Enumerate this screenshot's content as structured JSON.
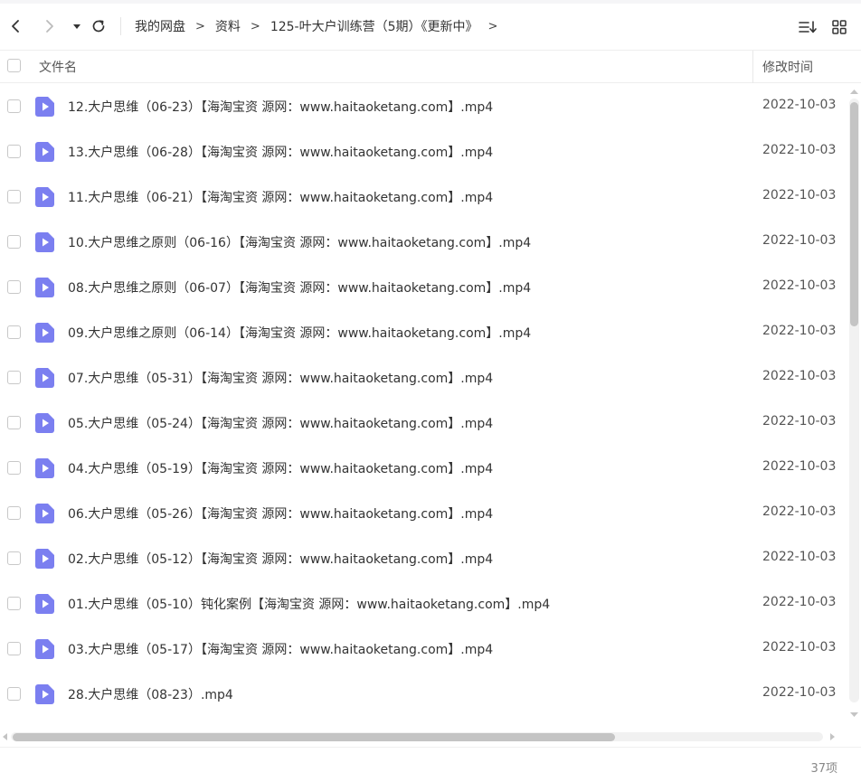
{
  "toolbar": {
    "back_icon": "chevron-left-icon",
    "forward_icon": "chevron-right-icon",
    "history_icon": "caret-down-icon",
    "refresh_icon": "refresh-icon",
    "breadcrumb": [
      "我的网盘",
      "资料",
      "125-叶大户训练营（5期）《更新中》"
    ],
    "crumb_separator": ">",
    "sort_icon": "sort-list-icon",
    "view_icon": "grid-view-icon"
  },
  "header": {
    "name_label": "文件名",
    "time_label": "修改时间"
  },
  "file_icon_color": "#7b7ff0",
  "files": [
    {
      "name": "12.大户思维（06-23）【海淘宝资 源网：www.haitaoketang.com】.mp4",
      "time": "2022-10-03 ("
    },
    {
      "name": "13.大户思维（06-28）【海淘宝资 源网：www.haitaoketang.com】.mp4",
      "time": "2022-10-03 ("
    },
    {
      "name": "11.大户思维（06-21）【海淘宝资 源网：www.haitaoketang.com】.mp4",
      "time": "2022-10-03 ("
    },
    {
      "name": "10.大户思维之原则（06-16）【海淘宝资 源网：www.haitaoketang.com】.mp4",
      "time": "2022-10-03 ("
    },
    {
      "name": "08.大户思维之原则（06-07）【海淘宝资 源网：www.haitaoketang.com】.mp4",
      "time": "2022-10-03 ("
    },
    {
      "name": "09.大户思维之原则（06-14）【海淘宝资 源网：www.haitaoketang.com】.mp4",
      "time": "2022-10-03 ("
    },
    {
      "name": "07.大户思维（05-31）【海淘宝资 源网：www.haitaoketang.com】.mp4",
      "time": "2022-10-03 ("
    },
    {
      "name": "05.大户思维（05-24）【海淘宝资 源网：www.haitaoketang.com】.mp4",
      "time": "2022-10-03 ("
    },
    {
      "name": "04.大户思维（05-19）【海淘宝资 源网：www.haitaoketang.com】.mp4",
      "time": "2022-10-03 ("
    },
    {
      "name": "06.大户思维（05-26）【海淘宝资 源网：www.haitaoketang.com】.mp4",
      "time": "2022-10-03 ("
    },
    {
      "name": "02.大户思维（05-12）【海淘宝资 源网：www.haitaoketang.com】.mp4",
      "time": "2022-10-03 ("
    },
    {
      "name": "01.大户思维（05-10）钝化案例【海淘宝资 源网：www.haitaoketang.com】.mp4",
      "time": "2022-10-03 ("
    },
    {
      "name": "03.大户思维（05-17）【海淘宝资 源网：www.haitaoketang.com】.mp4",
      "time": "2022-10-03 ("
    },
    {
      "name": "28.大户思维（08-23）.mp4",
      "time": "2022-10-03 ("
    }
  ],
  "footer": {
    "count": "37项"
  }
}
